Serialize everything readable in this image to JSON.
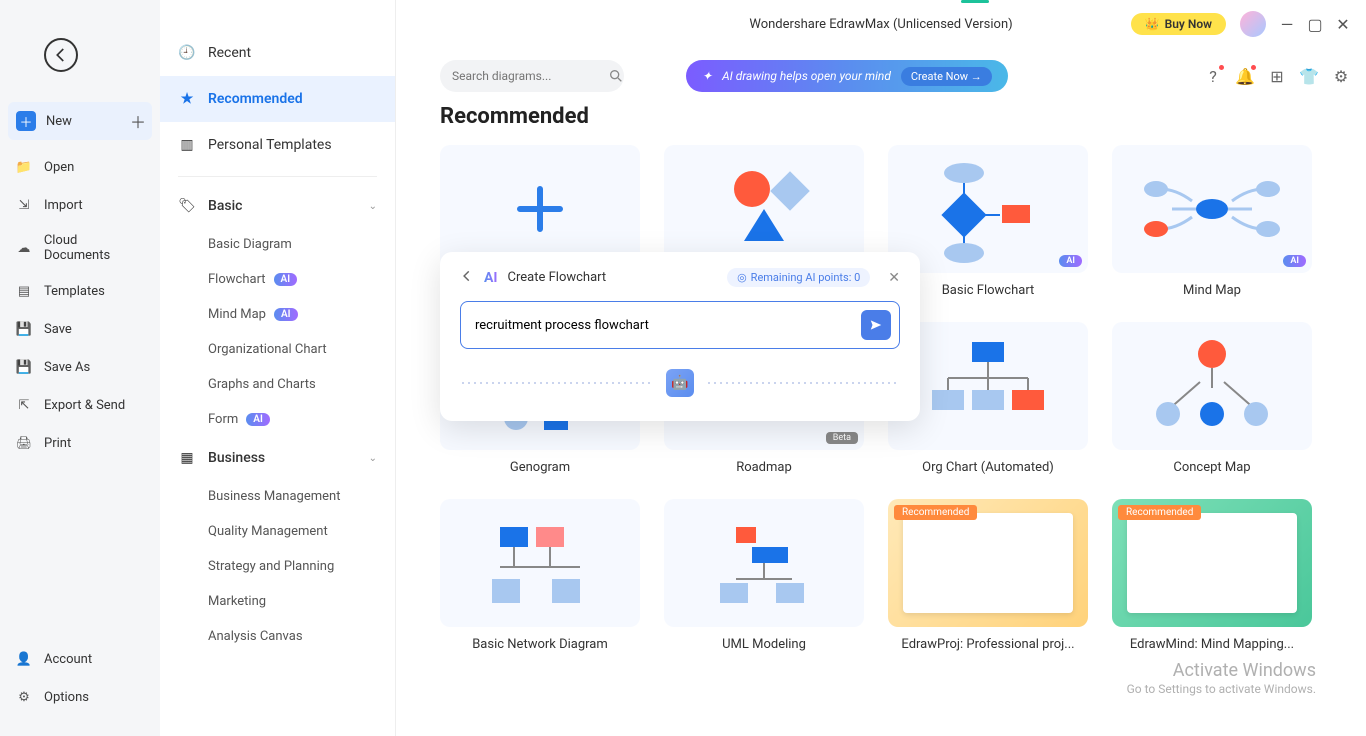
{
  "app": {
    "title": "Wondershare EdrawMax (Unlicensed Version)"
  },
  "top": {
    "buy": "Buy Now"
  },
  "rail": {
    "new": "New",
    "open": "Open",
    "import": "Import",
    "cloud": "Cloud Documents",
    "templates": "Templates",
    "save": "Save",
    "saveas": "Save As",
    "export": "Export & Send",
    "print": "Print",
    "account": "Account",
    "options": "Options"
  },
  "cats": {
    "recent": "Recent",
    "recommended": "Recommended",
    "personal": "Personal Templates",
    "basic": "Basic",
    "business": "Business",
    "basic_items": {
      "diagram": "Basic Diagram",
      "flowchart": "Flowchart",
      "mindmap": "Mind Map",
      "org": "Organizational Chart",
      "graphs": "Graphs and Charts",
      "form": "Form"
    },
    "business_items": {
      "mgmt": "Business Management",
      "quality": "Quality Management",
      "strategy": "Strategy and Planning",
      "marketing": "Marketing",
      "analysis": "Analysis Canvas"
    },
    "ai_badge": "AI"
  },
  "search": {
    "placeholder": "Search diagrams..."
  },
  "banner": {
    "text": "AI drawing helps open your mind",
    "cta": "Create Now"
  },
  "main": {
    "heading": "Recommended",
    "cards": {
      "blank": "",
      "flowchart": "Basic Flowchart",
      "mindmap": "Mind Map",
      "genogram": "Genogram",
      "roadmap": "Roadmap",
      "orgauto": "Org Chart (Automated)",
      "concept": "Concept Map",
      "network": "Basic Network Diagram",
      "uml": "UML Modeling",
      "edrawproj": "EdrawProj: Professional proj...",
      "edrawmind": "EdrawMind: Mind Mapping..."
    },
    "badge_ai": "AI",
    "badge_beta": "Beta",
    "badge_rec": "Recommended"
  },
  "modal": {
    "title": "Create Flowchart",
    "ai_label": "AI",
    "remaining": "Remaining AI points: 0",
    "input_value": "recruitment process flowchart"
  },
  "watermark": {
    "line1": "Activate Windows",
    "line2": "Go to Settings to activate Windows."
  }
}
